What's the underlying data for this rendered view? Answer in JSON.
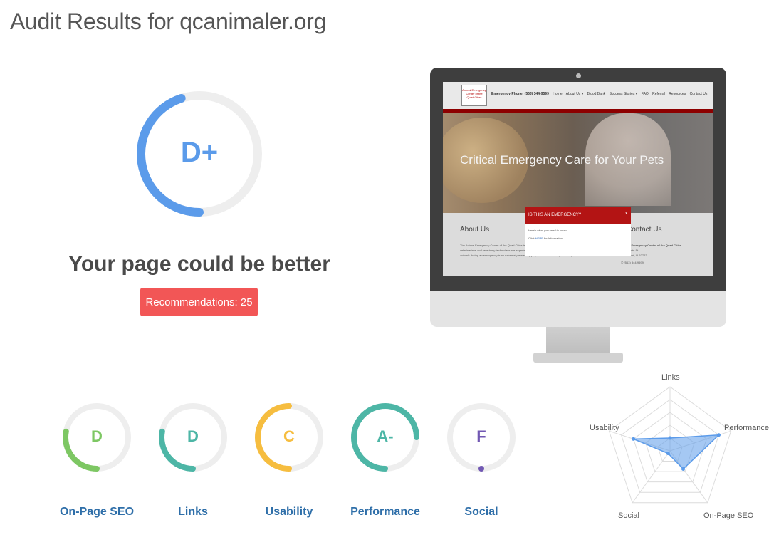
{
  "page": {
    "title": "Audit Results for qcanimaler.org"
  },
  "overall": {
    "grade": "D+",
    "progress": 0.45,
    "color": "#5b9bea",
    "summary": "Your page could be better",
    "recommendations_label": "Recommendations: 25"
  },
  "preview": {
    "nav_logo": "Animal Emergency Center of the Quad Cities",
    "nav_items": [
      "Emergency Phone: (563) 344-9599",
      "Home",
      "About Us ▾",
      "Blood Bank",
      "Success Stories ▾",
      "FAQ",
      "Referral",
      "Resources",
      "Contact Us"
    ],
    "hero_text": "Critical Emergency Care for Your Pets",
    "about_heading": "About Us",
    "about_text": "The Animal Emergency Center of the Quad Cities is an after-hours, critical care animal hospital in Bettendorf, IA. Our veterinarians and veterinary technicians are experienced and prepared to handle your emergent situation. Caring for animals during an emergency is an extremely rewarding job, and we take it very seriously.",
    "contact_heading": "Contact Us",
    "contact_name": "Animal Emergency Center of the Quad Cities",
    "contact_street": "2650 State St",
    "contact_city": "Bettendorf, IA 52722",
    "contact_phone": "✆ (563) 344-9599",
    "popup_title": "IS THIS AN EMERGENCY?",
    "popup_close": "x",
    "popup_line1": "Here's what you need to know",
    "popup_line2_pre": "Click ",
    "popup_line2_link": "HERE",
    "popup_line2_post": " for Information"
  },
  "categories": [
    {
      "name": "On-Page SEO",
      "grade": "D",
      "progress": 0.28,
      "color": "#7dc763"
    },
    {
      "name": "Links",
      "grade": "D",
      "progress": 0.28,
      "color": "#4db6a6"
    },
    {
      "name": "Usability",
      "grade": "C",
      "progress": 0.5,
      "color": "#f6bd3f"
    },
    {
      "name": "Performance",
      "grade": "A-",
      "progress": 0.75,
      "color": "#4db6a6"
    },
    {
      "name": "Social",
      "grade": "F",
      "progress": 0.0,
      "color": "#7158b3"
    }
  ],
  "radar": {
    "axes": [
      "Links",
      "Performance",
      "On-Page SEO",
      "Social",
      "Usability"
    ],
    "values": [
      0.2,
      0.8,
      0.35,
      0.05,
      0.6
    ],
    "color": "#5b9bea"
  }
}
